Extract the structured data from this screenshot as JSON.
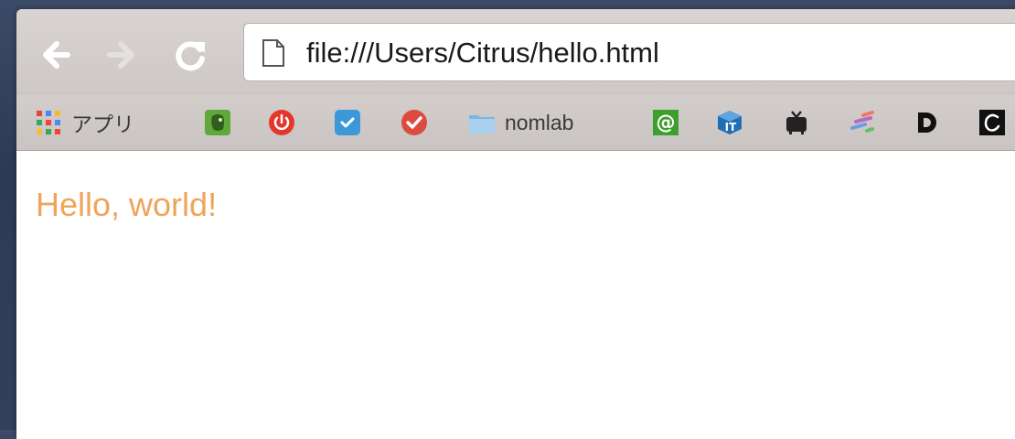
{
  "toolbar": {
    "back_icon": "back-arrow-icon",
    "forward_icon": "forward-arrow-icon",
    "reload_icon": "reload-icon",
    "url": "file:///Users/Citrus/hello.html"
  },
  "bookmarks": [
    {
      "label": "アプリ",
      "icon": "apps-grid-icon"
    },
    {
      "label": "",
      "icon": "evernote-icon",
      "color": "#5fa83a"
    },
    {
      "label": "",
      "icon": "power-icon",
      "color": "#e8352c"
    },
    {
      "label": "",
      "icon": "checkbox-icon",
      "color": "#3d98d8"
    },
    {
      "label": "",
      "icon": "todoist-check-icon",
      "color": "#db4c3f"
    },
    {
      "label": "nomlab",
      "icon": "folder-icon"
    },
    {
      "label": "",
      "icon": "at-sign-icon",
      "color": "#3ea02c"
    },
    {
      "label": "",
      "icon": "it-cube-icon",
      "color": "#1e6fb5"
    },
    {
      "label": "",
      "icon": "tv-icon",
      "color": "#222222"
    },
    {
      "label": "",
      "icon": "colorful-stripes-icon"
    },
    {
      "label": "",
      "icon": "d-logo-icon",
      "color": "#111111"
    },
    {
      "label": "",
      "icon": "script-c-icon",
      "color": "#111111"
    }
  ],
  "content": {
    "text": "Hello, world!",
    "text_color": "#f0a45a"
  }
}
